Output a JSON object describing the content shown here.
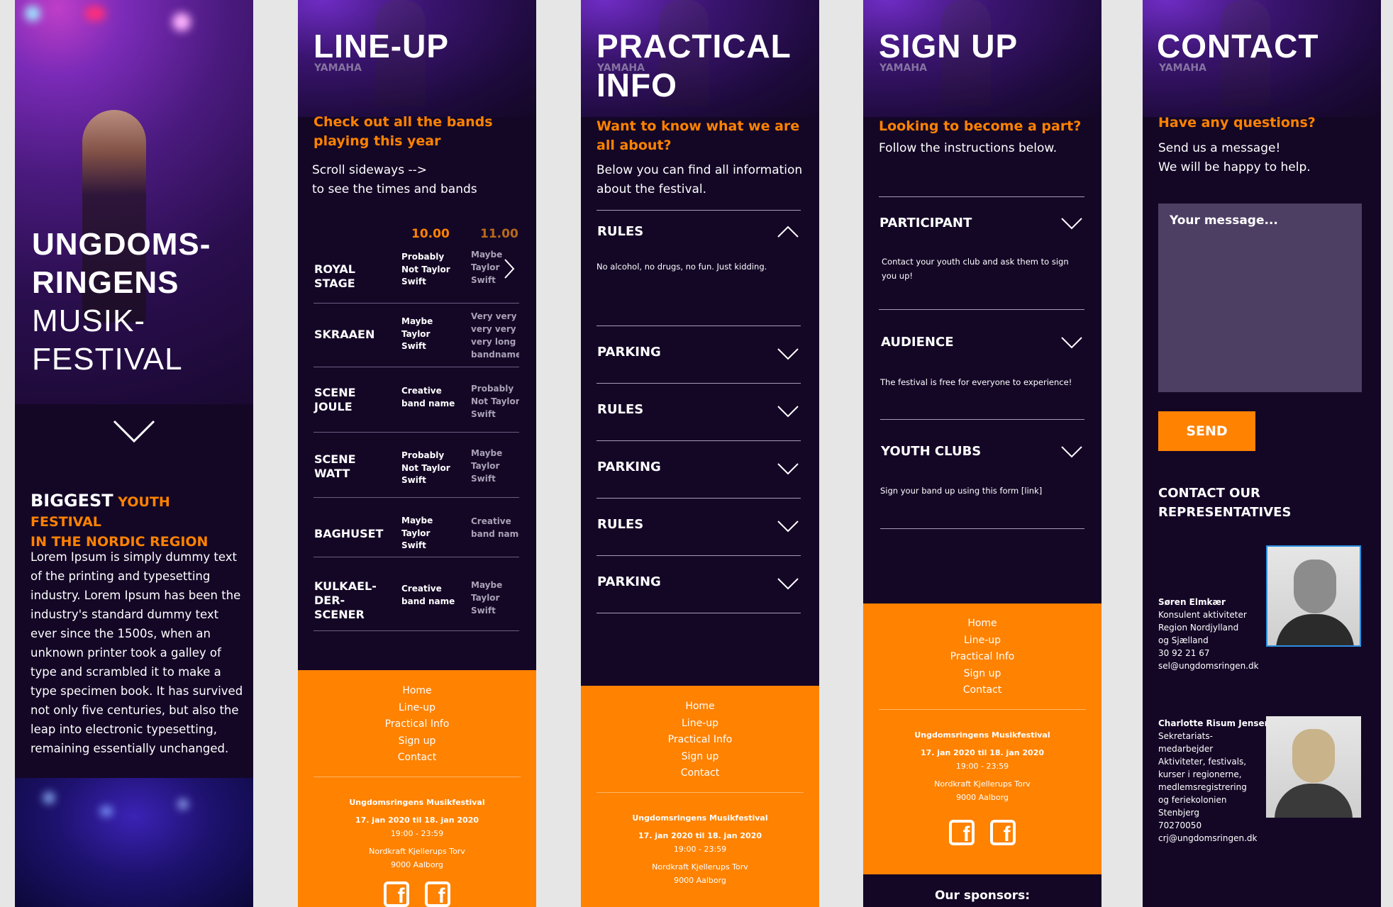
{
  "screen1": {
    "title_bold_1": "UNGDOMS-",
    "title_bold_2": "RINGENS",
    "title_thin_1": "MUSIK-",
    "title_thin_2": "FESTIVAL",
    "biggest_white": "BIGGEST",
    "biggest_orange_1": "YOUTH FESTIVAL",
    "biggest_orange_2": "IN THE NORDIC REGION",
    "lorem": "Lorem Ipsum is simply dummy text of the printing and typesetting industry. Lorem Ipsum has been the industry's standard dummy text ever since the 1500s, when an unknown printer took a galley of type and scrambled it to make a type specimen book. It has survived not only five centuries, but also the leap into electronic typesetting, remaining essentially unchanged."
  },
  "lineup": {
    "title": "LINE-UP",
    "subhead_1": "Check out all the bands",
    "subhead_2": "playing this year",
    "intro_1": "Scroll sideways -->",
    "intro_2": "to see the times and bands",
    "time_1": "10.00",
    "time_2": "11.00",
    "rows": [
      {
        "stage": [
          "ROYAL",
          "STAGE"
        ],
        "b1": [
          "Probably",
          "Not Taylor",
          "Swift"
        ],
        "b2": [
          "Maybe",
          "Taylor",
          "Swift"
        ]
      },
      {
        "stage": [
          "SKRAAEN"
        ],
        "b1": [
          "Maybe",
          "Taylor",
          "Swift"
        ],
        "b2": [
          "Very very",
          "very very",
          "very long",
          "bandname"
        ]
      },
      {
        "stage": [
          "SCENE",
          "JOULE"
        ],
        "b1": [
          "Creative",
          "band name"
        ],
        "b2": [
          "Probably",
          "Not Taylor",
          "Swift"
        ]
      },
      {
        "stage": [
          "SCENE",
          "WATT"
        ],
        "b1": [
          "Probably",
          "Not Taylor",
          "Swift"
        ],
        "b2": [
          "Maybe",
          "Taylor",
          "Swift"
        ]
      },
      {
        "stage": [
          "BAGHUSET"
        ],
        "b1": [
          "Maybe",
          "Taylor",
          "Swift"
        ],
        "b2": [
          "Creative",
          "band name"
        ]
      },
      {
        "stage": [
          "KULKAEL-",
          "DER-",
          "SCENER"
        ],
        "b1": [
          "Creative",
          "band name"
        ],
        "b2": [
          "Maybe",
          "Taylor",
          "Swift"
        ]
      }
    ]
  },
  "practical": {
    "title_1": "PRACTICAL",
    "title_2": "INFO",
    "subhead_1": "Want to know what we are",
    "subhead_2": "all about?",
    "intro_1": "Below you can find all information",
    "intro_2": "about the festival.",
    "acc": [
      "RULES",
      "PARKING",
      "RULES",
      "PARKING",
      "RULES",
      "PARKING"
    ],
    "rules_body": "No alcohol, no drugs, no fun. Just kidding."
  },
  "signup": {
    "title": "SIGN UP",
    "subhead": "Looking to become a part?",
    "intro": "Follow the instructions below.",
    "acc": [
      {
        "label": "PARTICIPANT",
        "body": "Contact your youth club and ask them to sign you up!"
      },
      {
        "label": "AUDIENCE",
        "body": "The festival is free for everyone to experience!"
      },
      {
        "label": "YOUTH CLUBS",
        "body": "Sign your band up using this form [link]"
      }
    ],
    "sponsors": "Our sponsors:"
  },
  "contact": {
    "title": "CONTACT",
    "subhead": "Have any questions?",
    "intro_1": "Send us a message!",
    "intro_2": "We will be happy to help.",
    "placeholder": "Your message...",
    "send": "SEND",
    "reps_1": "CONTACT OUR",
    "reps_2": "REPRESENTATIVES",
    "rep1": {
      "name": "Søren Elmkær",
      "lines": [
        "Konsulent aktiviteter",
        "Region Nordjylland",
        "og Sjælland",
        "30 92 21 67",
        "sel@ungdomsringen.dk"
      ]
    },
    "rep2": {
      "name": "Charlotte Risum Jensen",
      "lines": [
        "Sekretariats-",
        "medarbejder",
        "Aktiviteter, festivals,",
        "kurser i regionerne,",
        "medlemsregistrering",
        "og feriekolonien",
        "Stenbjerg",
        "70270050",
        "crj@ungdomsringen.dk"
      ]
    }
  },
  "footer": {
    "links": [
      "Home",
      "Line-up",
      "Practical Info",
      "Sign up",
      "Contact"
    ],
    "org": "Ungdomsringens Musikfestival",
    "dates": "17. jan 2020 til 18. jan 2020",
    "hours": "19:00 - 23:59",
    "address_1": "Nordkraft Kjellerups Torv",
    "address_2": "9000 Aalborg"
  },
  "colors": {
    "accent": "#ff8200",
    "background": "#140726",
    "input": "#4d3f63"
  }
}
